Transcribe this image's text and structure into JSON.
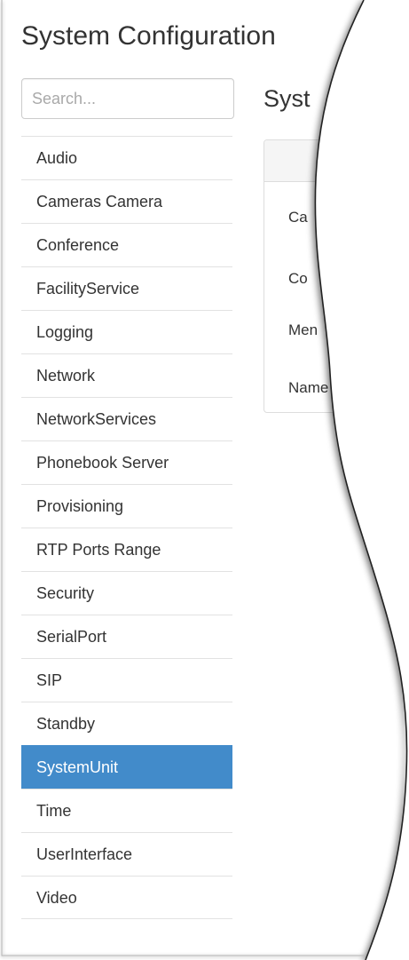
{
  "page": {
    "title": "System Configuration"
  },
  "search": {
    "placeholder": "Search..."
  },
  "nav": {
    "items": [
      {
        "label": "Audio"
      },
      {
        "label": "Cameras Camera"
      },
      {
        "label": "Conference"
      },
      {
        "label": "FacilityService"
      },
      {
        "label": "Logging"
      },
      {
        "label": "Network"
      },
      {
        "label": "NetworkServices"
      },
      {
        "label": "Phonebook Server"
      },
      {
        "label": "Provisioning"
      },
      {
        "label": "RTP Ports Range"
      },
      {
        "label": "Security"
      },
      {
        "label": "SerialPort"
      },
      {
        "label": "SIP"
      },
      {
        "label": "Standby"
      },
      {
        "label": "SystemUnit",
        "active": true
      },
      {
        "label": "Time"
      },
      {
        "label": "UserInterface"
      },
      {
        "label": "Video"
      }
    ]
  },
  "main": {
    "heading": "Syst",
    "rows": [
      {
        "label": "Ca"
      },
      {
        "label": "Co"
      },
      {
        "label": "Men"
      },
      {
        "label": "Name"
      }
    ]
  },
  "colors": {
    "active_bg": "#428bca",
    "active_text": "#ffffff",
    "border": "#e2e2e2",
    "text": "#333333"
  }
}
